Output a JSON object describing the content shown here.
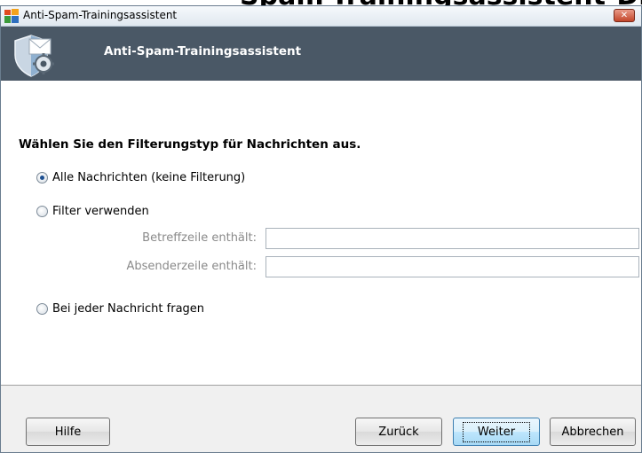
{
  "window": {
    "title": "Anti-Spam-Trainingsassistent",
    "close_glyph": "✕"
  },
  "banner": {
    "title": "Anti-Spam-Trainingsassistent",
    "icon": "shield-mail-gear-icon"
  },
  "form": {
    "heading": "Wählen Sie den Filterungstyp für Nachrichten aus.",
    "options": [
      {
        "label": "Alle Nachrichten (keine Filterung)",
        "selected": true
      },
      {
        "label": "Filter verwenden",
        "selected": false
      },
      {
        "label": "Bei jeder Nachricht fragen",
        "selected": false
      }
    ],
    "subject_label": "Betreffzeile enthält:",
    "subject_value": "",
    "sender_label": "Absenderzeile enthält:",
    "sender_value": ""
  },
  "buttons": {
    "help": "Hilfe",
    "back": "Zurück",
    "next": "Weiter",
    "cancel": "Abbrechen"
  },
  "colors": {
    "banner_bg": "#4a5866",
    "accent": "#1d4f91",
    "close_red": "#c24529"
  }
}
